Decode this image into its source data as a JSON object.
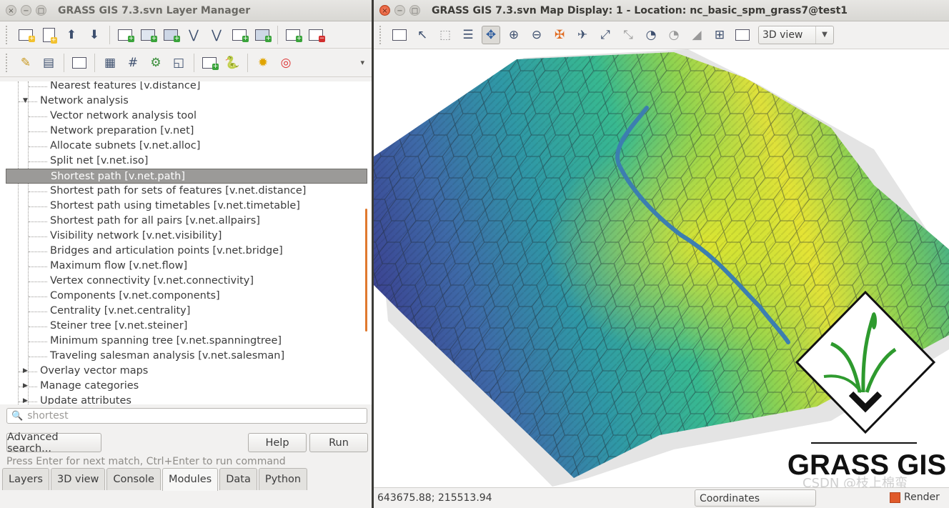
{
  "layer_manager": {
    "title": "GRASS GIS 7.3.svn Layer Manager",
    "tree_items": [
      {
        "label": "Nearest features  [v.distance]",
        "level": 2
      },
      {
        "label": "Network analysis",
        "level": 1,
        "expanded": true
      },
      {
        "label": "Vector network analysis tool",
        "level": 2
      },
      {
        "label": "Network preparation  [v.net]",
        "level": 2
      },
      {
        "label": "Allocate subnets  [v.net.alloc]",
        "level": 2
      },
      {
        "label": "Split net  [v.net.iso]",
        "level": 2
      },
      {
        "label": "Shortest path  [v.net.path]",
        "level": 2,
        "selected": true
      },
      {
        "label": "Shortest path for sets of features  [v.net.distance]",
        "level": 2
      },
      {
        "label": "Shortest path using timetables  [v.net.timetable]",
        "level": 2
      },
      {
        "label": "Shortest path for all pairs  [v.net.allpairs]",
        "level": 2
      },
      {
        "label": "Visibility network  [v.net.visibility]",
        "level": 2
      },
      {
        "label": "Bridges and articulation points  [v.net.bridge]",
        "level": 2
      },
      {
        "label": "Maximum flow  [v.net.flow]",
        "level": 2
      },
      {
        "label": "Vertex connectivity  [v.net.connectivity]",
        "level": 2
      },
      {
        "label": "Components  [v.net.components]",
        "level": 2
      },
      {
        "label": "Centrality  [v.net.centrality]",
        "level": 2
      },
      {
        "label": "Steiner tree  [v.net.steiner]",
        "level": 2
      },
      {
        "label": "Minimum spanning tree  [v.net.spanningtree]",
        "level": 2
      },
      {
        "label": "Traveling salesman analysis  [v.net.salesman]",
        "level": 2
      },
      {
        "label": "Overlay vector maps",
        "level": 1,
        "expanded": false
      },
      {
        "label": "Manage categories",
        "level": 1,
        "expanded": false
      },
      {
        "label": "Update attributes",
        "level": 1,
        "expanded": false
      }
    ],
    "search": {
      "value": "shortest"
    },
    "buttons": {
      "advanced": "Advanced search...",
      "help": "Help",
      "run": "Run"
    },
    "hint": "Press Enter for next match, Ctrl+Enter to run command",
    "tabs": [
      "Layers",
      "3D view",
      "Console",
      "Modules",
      "Data",
      "Python"
    ],
    "active_tab": "Modules"
  },
  "map_display": {
    "title": "GRASS GIS 7.3.svn Map Display: 1 - Location: nc_basic_spm_grass7@test1",
    "view_mode": "3D view",
    "coordinates": "643675.88; 215513.94",
    "coord_mode": "Coordinates",
    "render_label": "Render",
    "logo_text": "GRASS GIS",
    "watermark": "CSDN @枝上棉蛮"
  },
  "colors": {
    "accent_orange": "#e05a2a",
    "selection_gray": "#9b9a98",
    "logo_green": "#2e9a2e"
  }
}
